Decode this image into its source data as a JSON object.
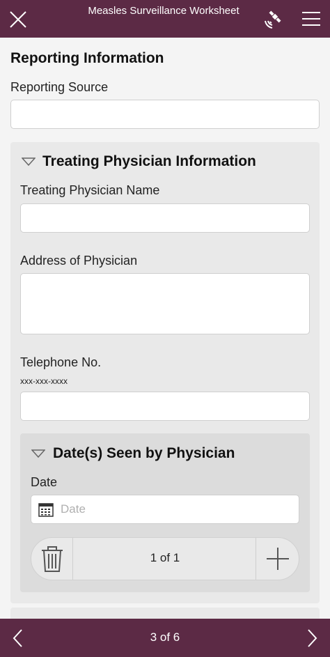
{
  "header": {
    "title": "Measles Surveillance Worksheet",
    "close_icon": "close-icon",
    "sync_icon": "satellite-icon",
    "menu_icon": "hamburger-menu-icon"
  },
  "reporting": {
    "section_title": "Reporting Information",
    "source_label": "Reporting Source",
    "source_value": ""
  },
  "physician": {
    "group_title": "Treating Physician Information",
    "name_label": "Treating Physician Name",
    "name_value": "",
    "address_label": "Address of Physician",
    "address_value": "",
    "phone_label": "Telephone No.",
    "phone_hint": "xxx-xxx-xxxx",
    "phone_value": ""
  },
  "dates_seen": {
    "group_title": "Date(s) Seen by Physician",
    "date_label": "Date",
    "date_placeholder": "Date",
    "date_value": "",
    "record_counter": "1 of 1"
  },
  "footer": {
    "page_indicator": "3 of 6"
  },
  "colors": {
    "brand": "#5c2a45",
    "panel": "#e9e9e9",
    "subpanel": "#dcdcdc"
  }
}
